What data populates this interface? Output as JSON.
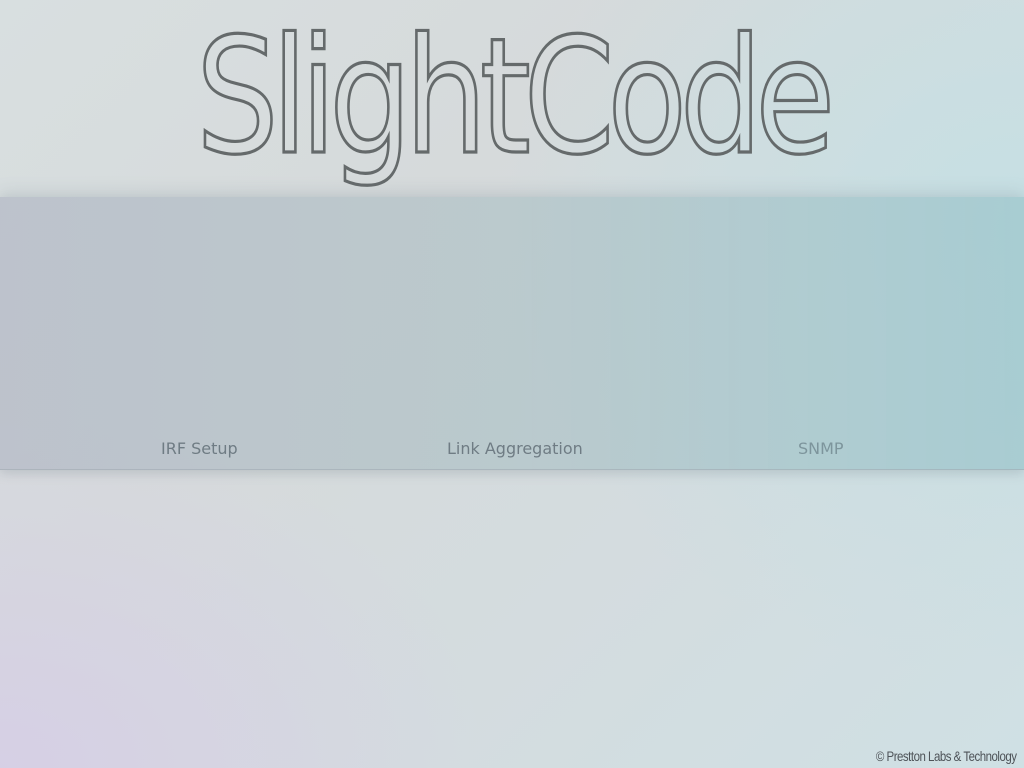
{
  "header": {
    "logo_text": "SlightCode"
  },
  "nav": {
    "items": [
      {
        "label": "IRF Setup"
      },
      {
        "label": "Link Aggregation"
      },
      {
        "label": "SNMP"
      }
    ]
  },
  "footer": {
    "copyright": "© Prestton Labs & Technology"
  },
  "colors": {
    "logo": "#656a6b",
    "nav_text": "#6f7c84",
    "nav_active": "#7d959c",
    "band": "#b4bec4"
  }
}
